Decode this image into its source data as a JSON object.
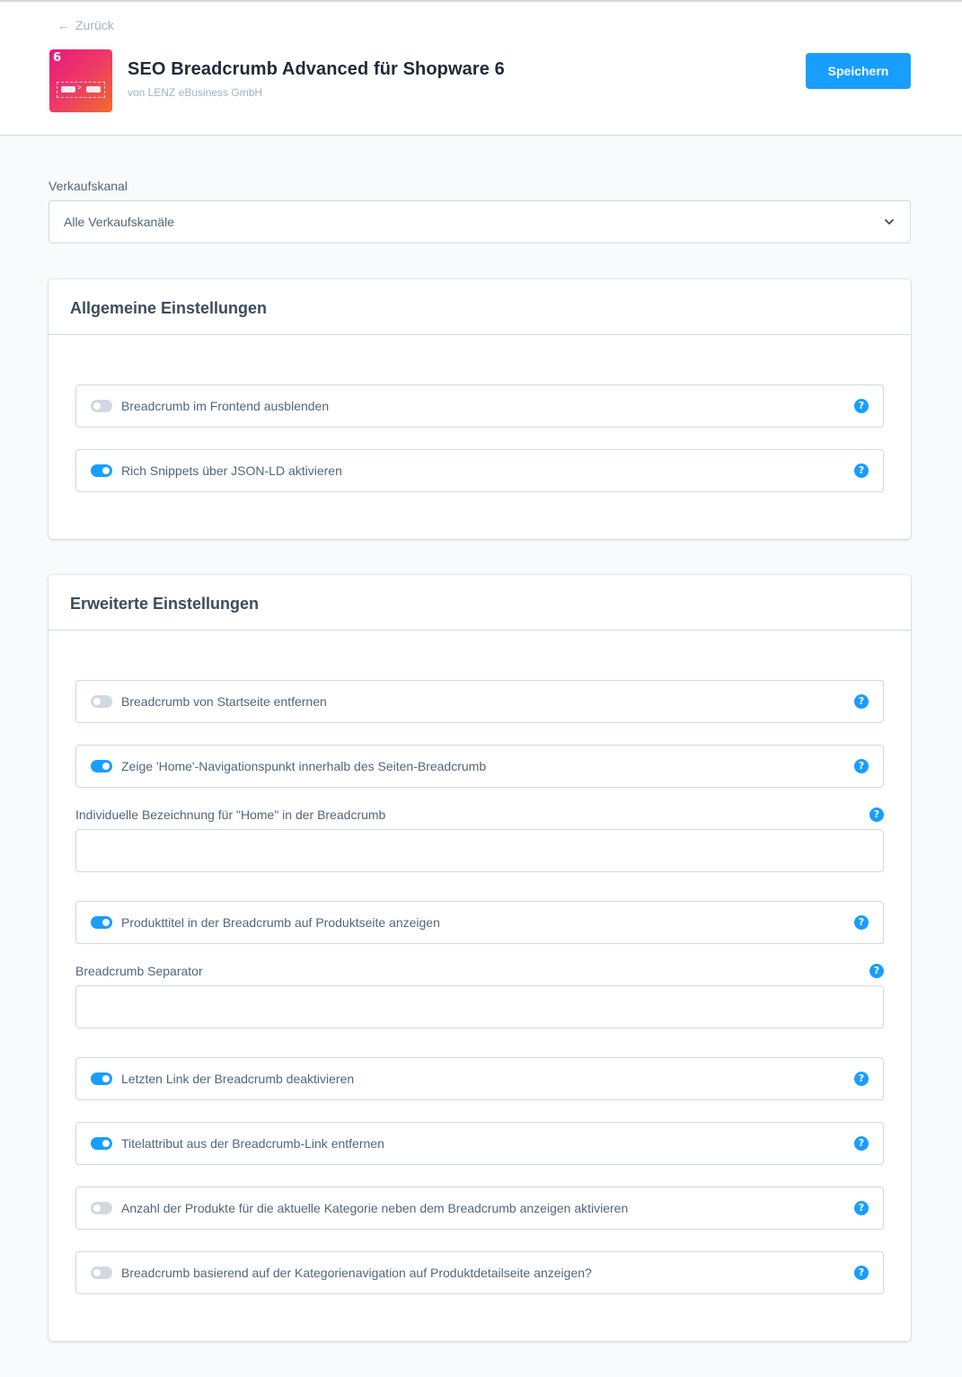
{
  "header": {
    "back_label": "Zurück",
    "title": "SEO Breadcrumb Advanced für Shopware 6",
    "vendor": "von LENZ eBusiness GmbH",
    "save_label": "Speichern",
    "icon_text": "6",
    "icon_separator": ">"
  },
  "sales_channel": {
    "label": "Verkaufskanal",
    "value": "Alle Verkaufskanäle"
  },
  "general": {
    "title": "Allgemeine Einstellungen",
    "items": [
      {
        "label": "Breadcrumb im Frontend ausblenden",
        "enabled": false
      },
      {
        "label": "Rich Snippets über JSON-LD aktivieren",
        "enabled": true
      }
    ]
  },
  "advanced": {
    "title": "Erweiterte Einstellungen",
    "toggle_remove_home": {
      "label": "Breadcrumb von Startseite entfernen",
      "enabled": false
    },
    "toggle_show_home": {
      "label": "Zeige 'Home'-Navigationspunkt innerhalb des Seiten-Breadcrumb",
      "enabled": true
    },
    "home_label_field": {
      "label": "Individuelle Bezeichnung für \"Home\" in der Breadcrumb",
      "value": ""
    },
    "toggle_product_title": {
      "label": "Produkttitel in der Breadcrumb auf Produktseite anzeigen",
      "enabled": true
    },
    "separator_field": {
      "label": "Breadcrumb Separator",
      "value": ""
    },
    "toggle_disable_last_link": {
      "label": "Letzten Link der Breadcrumb deaktivieren",
      "enabled": true
    },
    "toggle_remove_title_attr": {
      "label": "Titelattribut aus der Breadcrumb-Link entfernen",
      "enabled": true
    },
    "toggle_product_count": {
      "label": "Anzahl der Produkte für die aktuelle Kategorie neben dem Breadcrumb anzeigen aktivieren",
      "enabled": false
    },
    "toggle_category_nav": {
      "label": "Breadcrumb basierend auf der Kategorienavigation auf Produktdetailseite anzeigen?",
      "enabled": false
    }
  },
  "help_glyph": "?",
  "colors": {
    "accent": "#189eff",
    "toggle_off": "#d1d9e0",
    "border": "#d1d9e0",
    "icon_gradient_start": "#e9197f",
    "icon_gradient_end": "#f26b2a"
  }
}
